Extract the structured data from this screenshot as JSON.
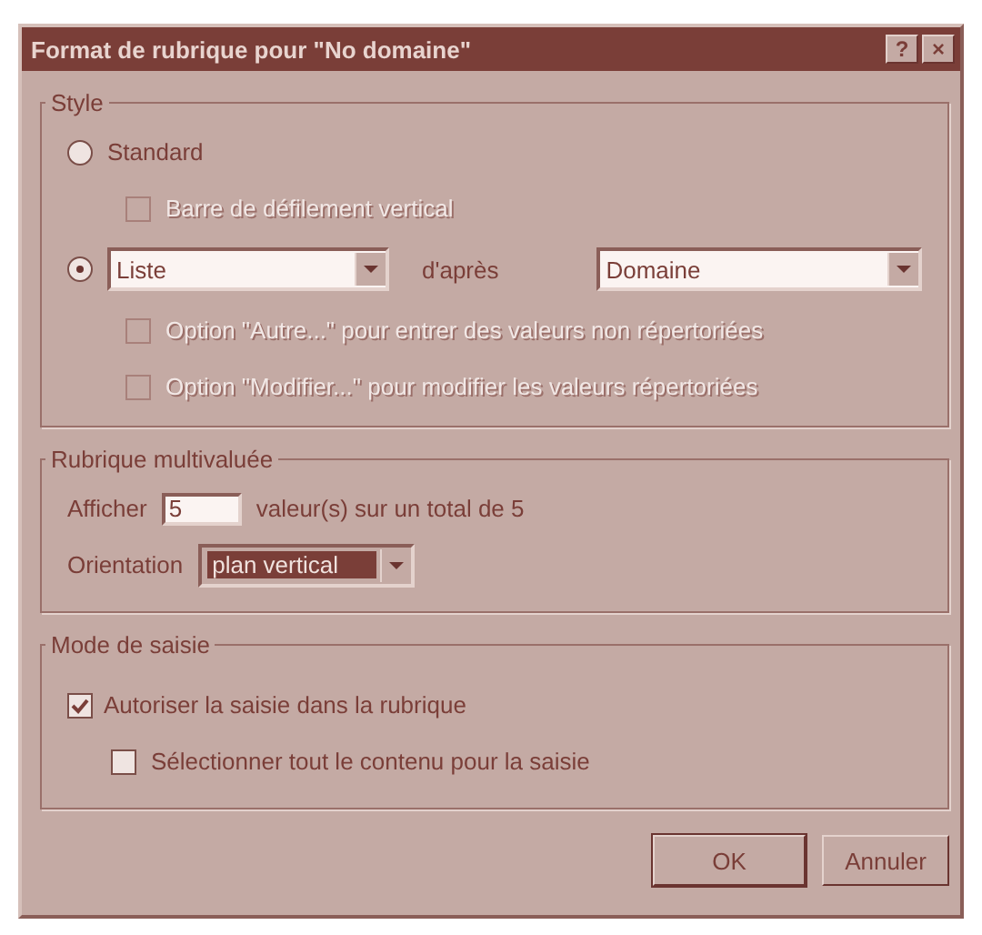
{
  "window": {
    "title": "Format de rubrique pour \"No domaine\"",
    "help": "?",
    "close": "×"
  },
  "style_group": {
    "title": "Style",
    "standard": {
      "label": "Standard",
      "selected": false
    },
    "scroll_option": {
      "label": "Barre de défilement vertical",
      "checked": false,
      "disabled": true
    },
    "list_radio": {
      "selected": true
    },
    "list_type": {
      "value": "Liste"
    },
    "after_label": "d'après",
    "value_list": {
      "value": "Domaine"
    },
    "list_options": [
      {
        "label": "Option \"Autre...\" pour entrer des valeurs non répertoriées",
        "checked": false,
        "disabled": true
      },
      {
        "label": "Option \"Modifier...\" pour modifier les valeurs répertoriées",
        "checked": false,
        "disabled": true
      }
    ]
  },
  "multi_group": {
    "title": "Rubrique multivaluée",
    "show_label": "Afficher",
    "show_value": "5",
    "show_suffix": "valeur(s) sur un total de 5",
    "orientation_label": "Orientation",
    "orientation": {
      "value": "plan vertical",
      "selected": true
    }
  },
  "entry_group": {
    "title": "Mode de saisie",
    "options": [
      {
        "label": "Autoriser la saisie dans la rubrique",
        "checked": true,
        "indented": false
      },
      {
        "label": "Sélectionner tout le contenu pour la saisie",
        "checked": false,
        "indented": true
      }
    ]
  },
  "buttons": [
    "OK",
    "Annuler"
  ]
}
